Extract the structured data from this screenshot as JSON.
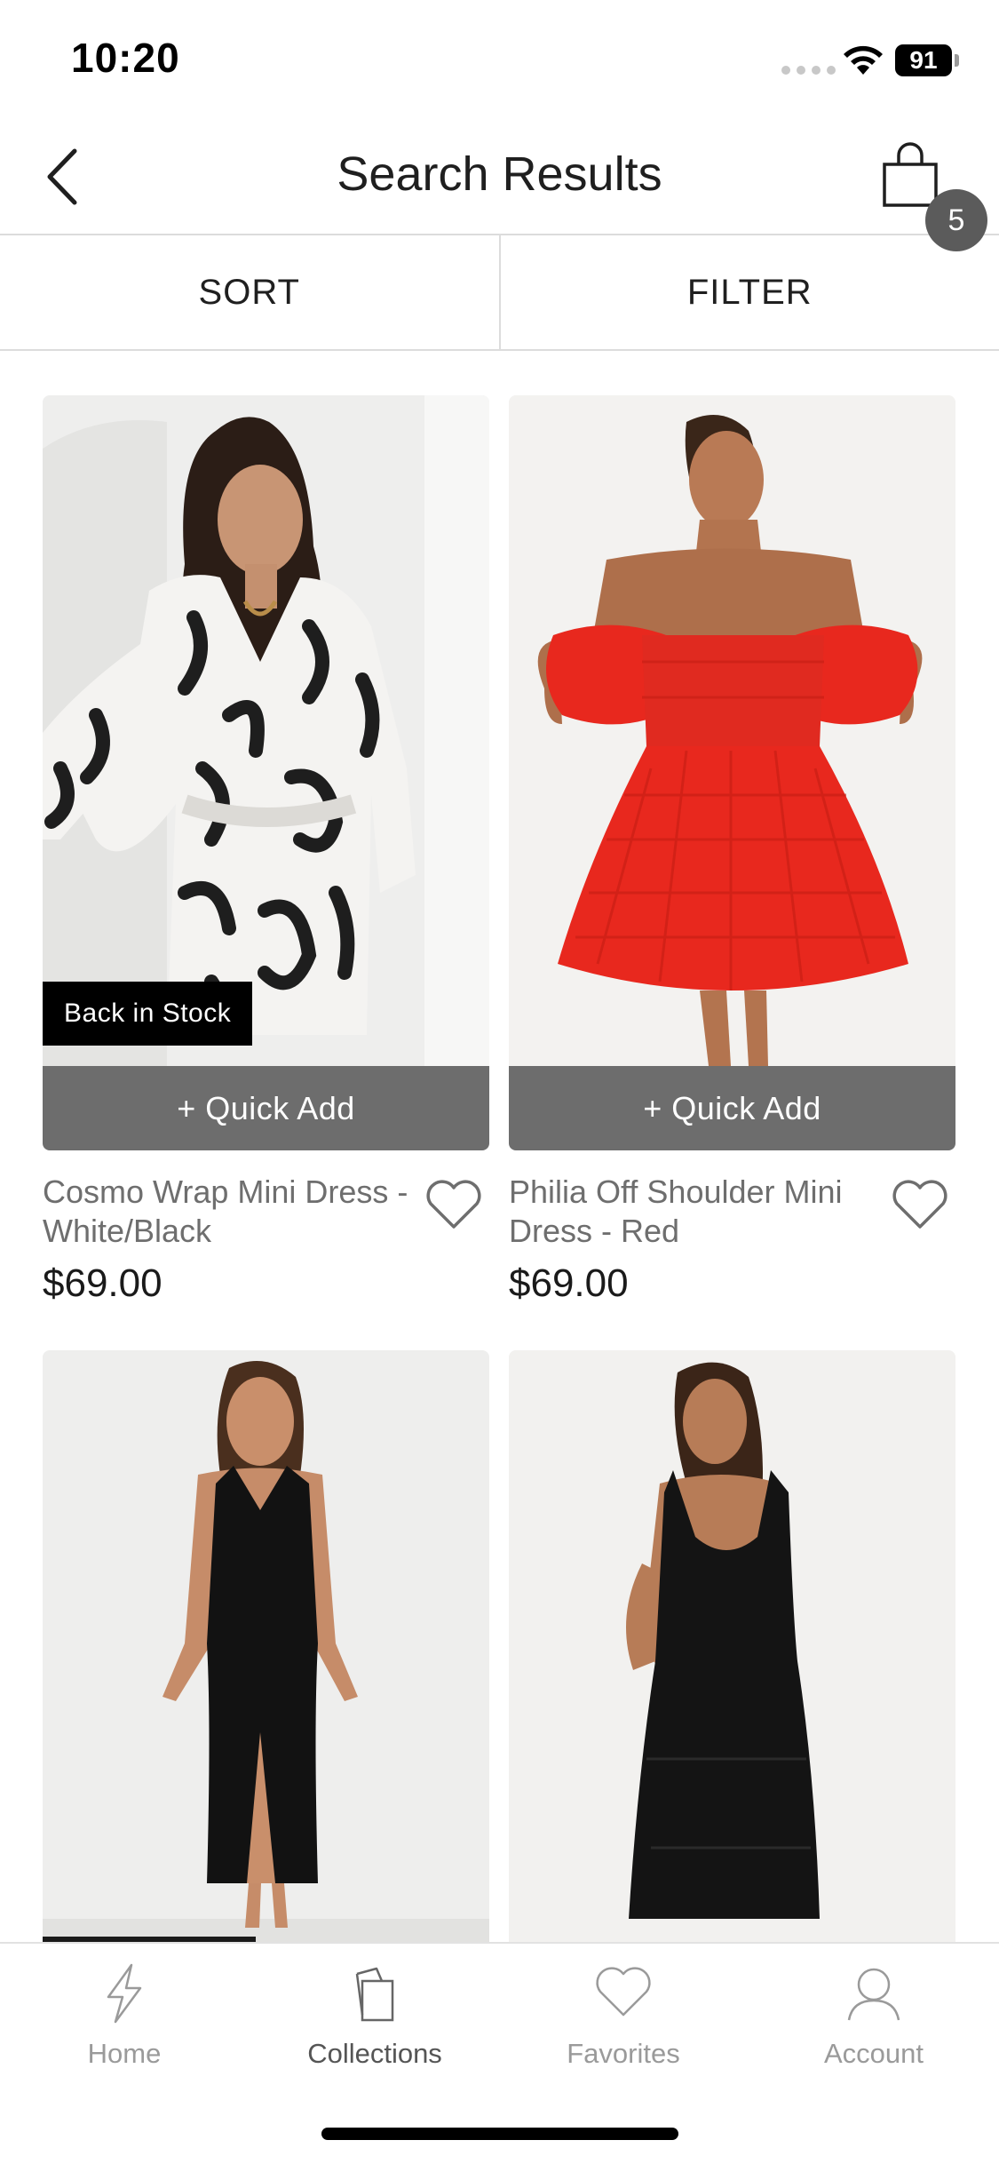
{
  "status_bar": {
    "time": "10:20",
    "battery": "91"
  },
  "header": {
    "title": "Search Results",
    "cart_count": "5"
  },
  "toolbar": {
    "sort_label": "SORT",
    "filter_label": "FILTER"
  },
  "products": [
    {
      "name": "Cosmo Wrap Mini Dress - White/Black",
      "price": "$69.00",
      "badge": "Back in Stock",
      "quick_add": "+ Quick Add",
      "image": "dress-white-black-print-photo"
    },
    {
      "name": "Philia Off Shoulder Mini Dress - Red",
      "price": "$69.00",
      "quick_add": "+ Quick Add",
      "image": "dress-red-off-shoulder-photo"
    },
    {
      "image": "dress-black-halter-midi-photo"
    },
    {
      "image": "dress-black-tiered-maxi-photo"
    }
  ],
  "bottom_nav": {
    "items": [
      {
        "label": "Home",
        "icon": "bolt-icon"
      },
      {
        "label": "Collections",
        "icon": "collections-icon"
      },
      {
        "label": "Favorites",
        "icon": "heart-icon"
      },
      {
        "label": "Account",
        "icon": "user-icon"
      }
    ],
    "active": "Collections"
  },
  "colors": {
    "quick_add_bg": "#6d6d6d",
    "badge_bg": "#000000",
    "cart_badge_bg": "#5b5b5b",
    "nav_label": "#9a9a9a",
    "red_dress": "#e8281e"
  }
}
